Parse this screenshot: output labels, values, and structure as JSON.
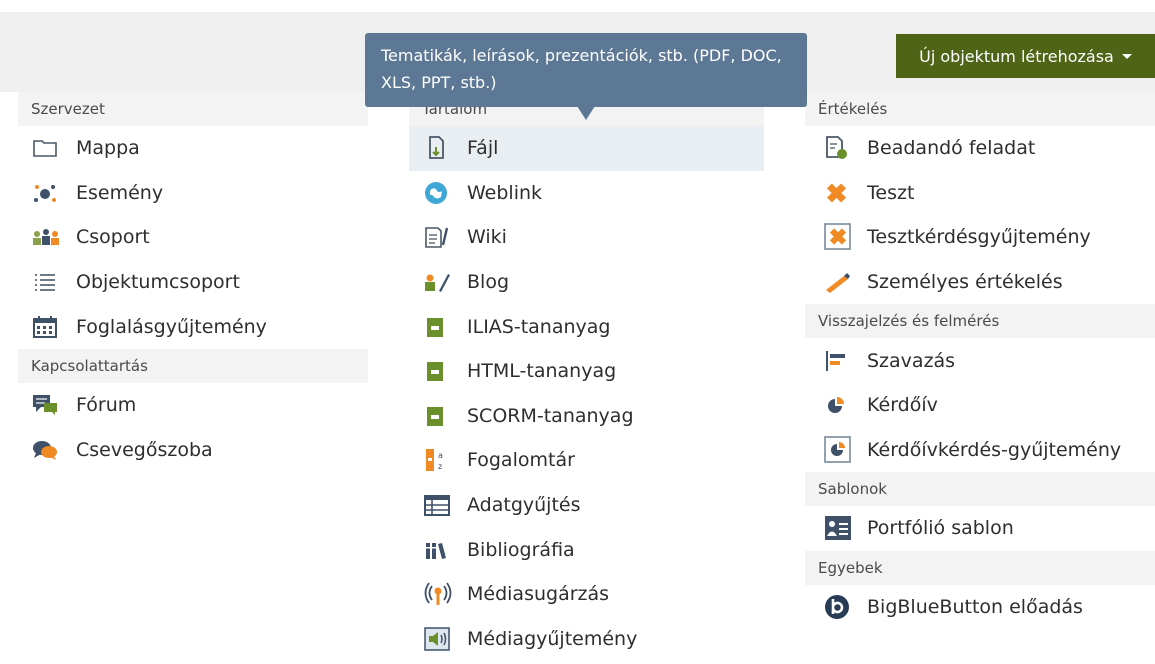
{
  "header": {
    "create_button_label": "Új objektum létrehozása"
  },
  "tooltip": {
    "text": "Tematikák, leírások, prezentációk, stb. (PDF, DOC, XLS, PPT, stb.)"
  },
  "menu": {
    "col1": {
      "sections": [
        {
          "title": "Szervezet",
          "items": [
            "Mappa",
            "Esemény",
            "Csoport",
            "Objektumcsoport",
            "Foglalásgyűjtemény"
          ]
        },
        {
          "title": "Kapcsolattartás",
          "items": [
            "Fórum",
            "Csevegőszoba"
          ]
        }
      ]
    },
    "col2": {
      "sections": [
        {
          "title": "Tartalom",
          "items": [
            "Fájl",
            "Weblink",
            "Wiki",
            "Blog",
            "ILIAS-tananyag",
            "HTML-tananyag",
            "SCORM-tananyag",
            "Fogalomtár",
            "Adatgyűjtés",
            "Bibliográfia",
            "Médiasugárzás",
            "Médiagyűjtemény"
          ]
        }
      ]
    },
    "col3": {
      "sections": [
        {
          "title": "Értékelés",
          "items": [
            "Beadandó feladat",
            "Teszt",
            "Tesztkérdésgyűjtemény",
            "Személyes értékelés"
          ]
        },
        {
          "title": "Visszajelzés és felmérés",
          "items": [
            "Szavazás",
            "Kérdőív",
            "Kérdőívkérdés-gyűjtemény"
          ]
        },
        {
          "title": "Sablonok",
          "items": [
            "Portfólió sablon"
          ]
        },
        {
          "title": "Egyebek",
          "items": [
            "BigBlueButton előadás"
          ]
        }
      ]
    }
  },
  "colors": {
    "button_green": "#4f6416",
    "tooltip_blue": "#5c7895",
    "section_bg": "#f3f3f3",
    "active_row": "#e9eef3"
  }
}
